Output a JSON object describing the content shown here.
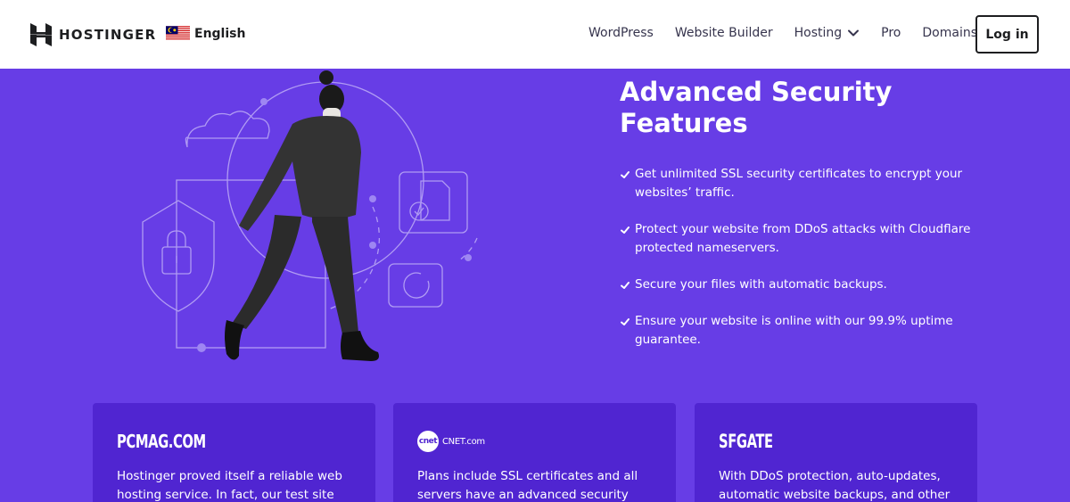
{
  "header": {
    "logo_text": "HOSTINGER",
    "language": "English",
    "nav": [
      {
        "label": "WordPress"
      },
      {
        "label": "Website Builder"
      },
      {
        "label": "Hosting"
      },
      {
        "label": "Pro"
      },
      {
        "label": "Domains"
      }
    ],
    "login_label": "Log in"
  },
  "hero": {
    "title_line1": "Advanced Security",
    "title_line2": "Features",
    "features": [
      {
        "line1": "Get unlimited SSL security certificates to encrypt your",
        "line2": "websites’ traffic."
      },
      {
        "line1": "Protect your website from DDoS attacks with Cloudflare",
        "line2": "protected nameservers."
      },
      {
        "line1": "Secure your files with automatic backups.",
        "line2": ""
      },
      {
        "line1": "Ensure your website is online with our 99.9% uptime",
        "line2": "guarantee."
      }
    ]
  },
  "cards": [
    {
      "brand": "PCMAG.COM",
      "line1": "Hostinger proved itself a reliable web",
      "line2": "hosting service. In fact, our test site"
    },
    {
      "brand_logo": "cnet",
      "brand": "CNET.com",
      "line1": "Plans include SSL certificates and all",
      "line2": "servers have an advanced security"
    },
    {
      "brand": "SFGATE",
      "line1": "With DDoS protection, auto-updates,",
      "line2": "automatic website backups, and other"
    }
  ],
  "colors": {
    "background": "#673de6",
    "card": "#5025d1",
    "header": "#ffffff",
    "text_dark": "#1d1e20"
  },
  "icons": {
    "logo": "hostinger-logo-icon",
    "flag": "malaysia-flag-icon",
    "chevron": "chevron-down-icon",
    "check": "check-icon"
  }
}
